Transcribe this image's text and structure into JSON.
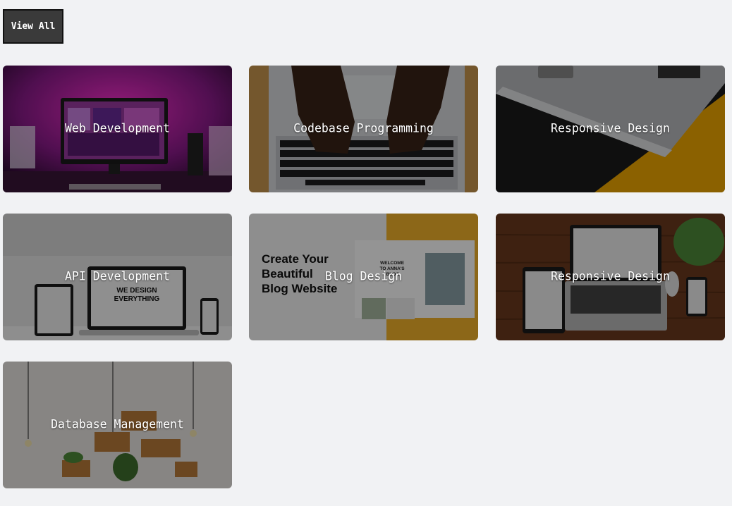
{
  "view_all_label": "View All",
  "cards": [
    {
      "title": "Web Development",
      "image": "desk-monitor-neon-photo"
    },
    {
      "title": "Codebase Programming",
      "image": "hands-typing-laptop-photo"
    },
    {
      "title": "Responsive Design",
      "image": "laptop-corner-yellow-photo"
    },
    {
      "title": "API Development",
      "image": "devices-mockup-photo"
    },
    {
      "title": "Blog Design",
      "image": "blog-template-mockup",
      "image_text": {
        "headline": "Create Your Beautiful Blog Website",
        "welcome": "WELCOME TO ANNA'S BLOG"
      }
    },
    {
      "title": "Responsive Design",
      "image": "devices-on-wood-table-photo"
    },
    {
      "title": "Database Management",
      "image": "wall-shelves-plants-photo"
    }
  ]
}
